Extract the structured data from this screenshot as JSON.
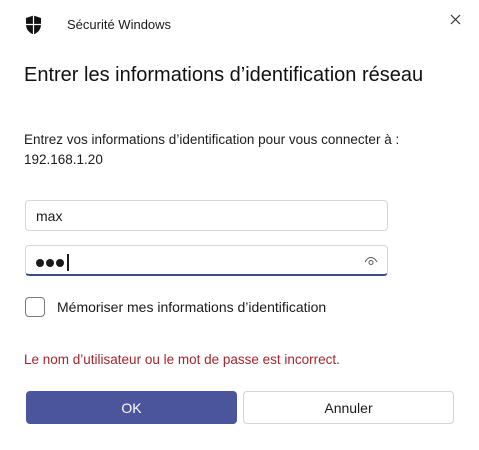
{
  "window": {
    "title": "Sécurité Windows",
    "close_icon": "close-icon"
  },
  "dialog": {
    "heading": "Entrer les informations d’identification réseau",
    "description": "Entrez vos informations d’identification pour vous connecter à :",
    "target": "192.168.1.20"
  },
  "form": {
    "username_value": "max",
    "password_masked_length": 3,
    "password_focused": true,
    "reveal_icon": "eye-icon",
    "remember_label": "Mémoriser mes informations d’identification",
    "remember_checked": false
  },
  "error_message": "Le nom d’utilisateur ou le mot de passe est incorrect.",
  "buttons": {
    "ok_label": "OK",
    "cancel_label": "Annuler"
  },
  "colors": {
    "primary": "#4b559b",
    "error": "#a4262c",
    "focus_underline": "#3f4d86"
  }
}
